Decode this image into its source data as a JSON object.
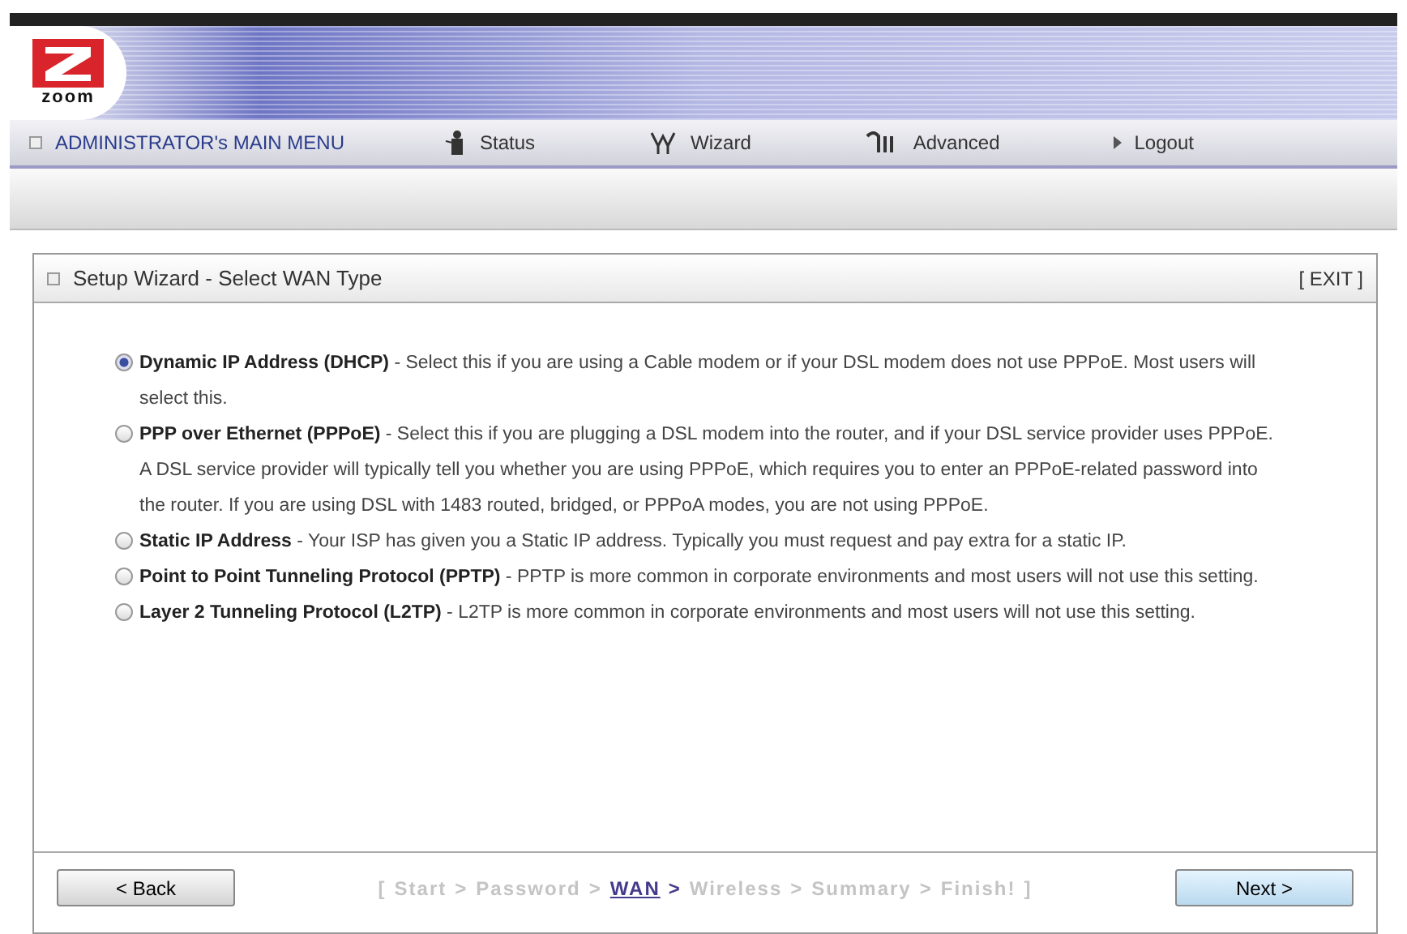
{
  "logo": {
    "text": "zoom"
  },
  "nav": {
    "menu_title": "ADMINISTRATOR's MAIN MENU",
    "items": [
      {
        "label": "Status",
        "kind": "person"
      },
      {
        "label": "Wizard",
        "kind": "wizard"
      },
      {
        "label": "Advanced",
        "kind": "tools"
      },
      {
        "label": "Logout",
        "kind": "arrow"
      }
    ]
  },
  "panel": {
    "title": "Setup Wizard - Select WAN Type",
    "exit": "[ EXIT ]",
    "options": [
      {
        "label": "Dynamic IP Address (DHCP)",
        "description": " - Select this if you are using a Cable modem or if your DSL modem does not use PPPoE. Most users will select this.",
        "selected": true
      },
      {
        "label": "PPP over Ethernet (PPPoE)",
        "description": " - Select this if you are plugging a DSL modem into the router, and if your DSL service provider uses PPPoE. A DSL service provider will typically tell you whether you are using PPPoE, which requires you to enter an PPPoE-related password into the router. If you are using DSL with 1483 routed, bridged, or PPPoA modes, you are not using PPPoE.",
        "selected": false
      },
      {
        "label": "Static IP Address",
        "description": " - Your ISP has given you a Static IP address. Typically you must request and pay extra for a static IP.",
        "selected": false
      },
      {
        "label": "Point to Point Tunneling Protocol (PPTP)",
        "description": " - PPTP is more common in corporate environments and most users will not use this setting.",
        "selected": false
      },
      {
        "label": "Layer 2 Tunneling Protocol (L2TP)",
        "description": " - L2TP is more common in corporate environments and most users will not use this setting.",
        "selected": false
      }
    ],
    "back": "< Back",
    "next": "Next >",
    "breadcrumb": {
      "open": "[",
      "close": "]",
      "steps": [
        {
          "label": "Start",
          "selected": false,
          "separator": ">"
        },
        {
          "label": "Password",
          "selected": false,
          "separator": ">"
        },
        {
          "label": "WAN",
          "selected": true,
          "separator": ">"
        },
        {
          "label": "Wireless",
          "selected": false,
          "separator": ">"
        },
        {
          "label": "Summary",
          "selected": false,
          "separator": ">"
        },
        {
          "label": "Finish!",
          "selected": false
        }
      ]
    }
  }
}
